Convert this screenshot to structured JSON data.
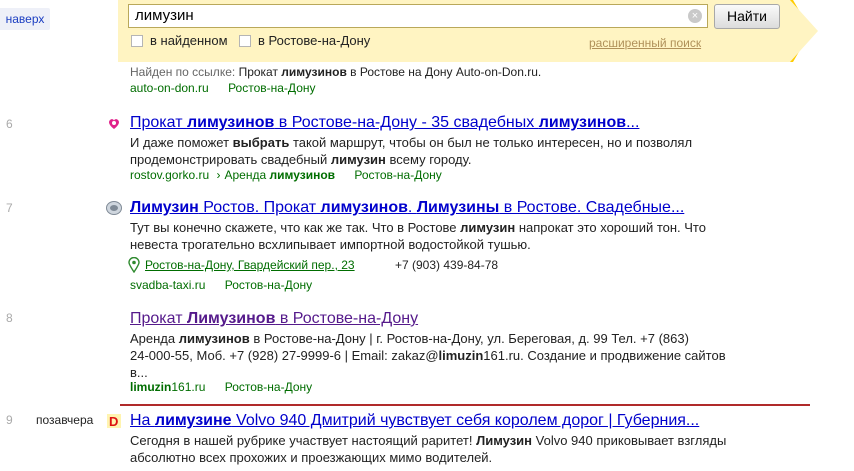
{
  "nav": {
    "up_label": "наверх"
  },
  "search": {
    "query": "лимузин",
    "button_label": "Найти",
    "check_found_label": "в найденном",
    "check_region_label": "в Ростове-на-Дону",
    "advanced_label": "расширенный поиск"
  },
  "found_by_link": {
    "prefix": "Найден по ссылке:",
    "text": "Прокат лимузинов в Ростове на Дону Auto-on-Don.ru.",
    "site": "auto-on-don.ru",
    "region": "Ростов-на-Дону"
  },
  "results": [
    {
      "num": "6",
      "title": "Прокат лимузинов в Ростове-на-Дону - 35 свадебных лимузинов...",
      "snippet1": "И даже поможет выбрать такой маршрут, чтобы он был не только интересен, но и позволял",
      "snippet2": "продемонстрировать свадебный лимузин всему городу.",
      "site": "rostov.gorko.ru",
      "path_sep": "›",
      "path": "Аренда лимузинов",
      "region": "Ростов-на-Дону"
    },
    {
      "num": "7",
      "title": "Лимузин Ростов. Прокат лимузинов. Лимузины в Ростове. Свадебные...",
      "snippet1": "Тут вы конечно скажете, что как же так. Что в Ростове лимузин напрокат это хороший тон. Что",
      "snippet2": "невеста трогательно всхлипывает импортной водостойкой тушью.",
      "address": "Ростов-на-Дону, Гвардейский пер., 23",
      "phone": "+7 (903) 439-84-78",
      "site": "svadba-taxi.ru",
      "region": "Ростов-на-Дону"
    },
    {
      "num": "8",
      "title": "Прокат Лимузинов в Ростове-на-Дону",
      "snippet1": "Аренда лимузинов в Ростове-на-Дону | г. Ростов-на-Дону, ул. Береговая, д. 99 Тел. +7 (863)",
      "snippet2": "24-000-55, Моб. +7 (928) 27-9999-6 | Email: zakaz@limuzin161.ru. Создание и продвижение сайтов",
      "snippet3": "в...",
      "site": "limuzin161.ru",
      "region": "Ростов-на-Дону"
    },
    {
      "num": "9",
      "date": "позавчера",
      "title": "На лимузине Volvo 940 Дмитрий чувствует себя королем дорог | Губерния...",
      "snippet1": "Сегодня в нашей рубрике участвует настоящий раритет! Лимузин Volvo 940 приковывает взгляды",
      "snippet2": "абсолютно всех прохожих и проезжающих мимо водителей."
    }
  ],
  "colors": {
    "search_band": "#ffcc00",
    "link": "#0000cc",
    "visited": "#551a8b",
    "green": "#006d00",
    "divider": "#b02a2a"
  }
}
